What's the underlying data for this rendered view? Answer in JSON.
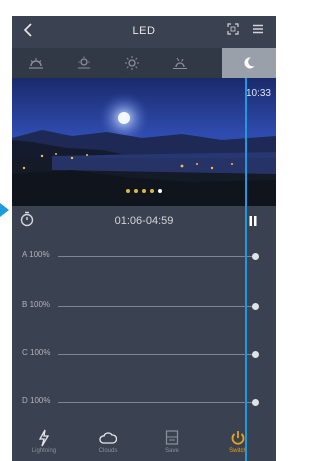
{
  "header": {
    "title": "LED",
    "back_icon": "chevron-left-icon",
    "right_icons": [
      "fullscreen-icon",
      "menu-icon"
    ]
  },
  "mode_tabs": [
    {
      "icon": "sunrise-icon",
      "active": false
    },
    {
      "icon": "sun-high-icon",
      "active": false
    },
    {
      "icon": "sun-icon",
      "active": false
    },
    {
      "icon": "sunset-icon",
      "active": false
    },
    {
      "icon": "moon-icon",
      "active": true
    }
  ],
  "preview": {
    "time": "10:33"
  },
  "schedule": {
    "time_range": "01:06-04:59"
  },
  "channels": [
    {
      "label": "A",
      "value": "100%"
    },
    {
      "label": "B",
      "value": "100%"
    },
    {
      "label": "C",
      "value": "100%"
    },
    {
      "label": "D",
      "value": "100%"
    }
  ],
  "bottom_nav": [
    {
      "label": "Lightning",
      "icon": "lightning-icon",
      "active": false
    },
    {
      "label": "Clouds",
      "icon": "cloud-icon",
      "active": false
    },
    {
      "label": "Save",
      "icon": "save-icon",
      "active": false
    },
    {
      "label": "Switch",
      "icon": "power-icon",
      "active": true
    }
  ],
  "colors": {
    "accent": "#1e9be0",
    "active_nav": "#e8a21b",
    "background": "#3a4150"
  }
}
